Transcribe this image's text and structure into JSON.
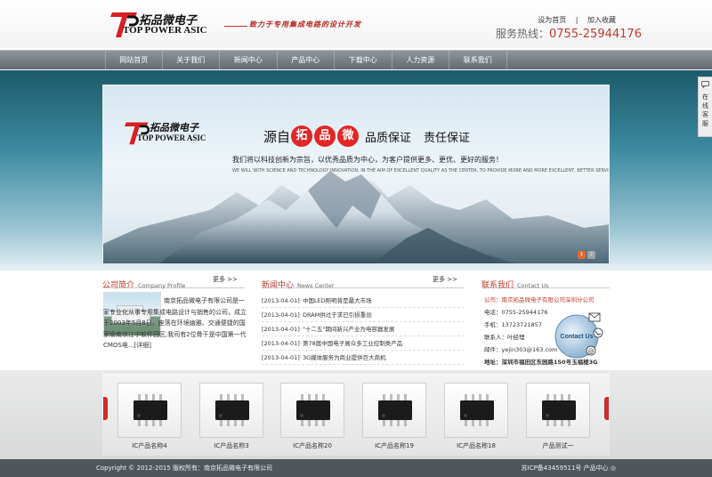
{
  "header": {
    "logo_cn": "拓品微电子",
    "logo_en": "TOP POWER ASIC",
    "slogan": "致力于专用集成电路的设计开发",
    "set_home": "设为首页",
    "separator": "|",
    "add_favorite": "加入收藏",
    "hotline_label": "服务热线：",
    "hotline_number": "0755-25944176"
  },
  "nav": {
    "items": [
      "网站首页",
      "关于我们",
      "新闻中心",
      "产品中心",
      "下载中心",
      "人力资源",
      "联系我们"
    ]
  },
  "banner": {
    "logo_cn": "拓品微电子",
    "logo_en": "TOP POWER ASIC",
    "headline_pre": "源自",
    "headline_chars": [
      "拓",
      "品",
      "微"
    ],
    "headline_mid": "品质保证",
    "headline_post": "责任保证",
    "line_cn": "我们将以科技创新为宗旨，以优秀品质为中心，为客户提供更多、更优、更好的服务！",
    "line_en": "WE WILL WITH SCIENCE AND TECHNOLOGY INNOVATION, IN THE AIM OF EXCELLENT QUALITY AS THE CENTER, TO PROVIDE MORE AND MORE EXCELLENT, BETTER SERVICE!",
    "dots": [
      "1",
      "2"
    ]
  },
  "side_tab": {
    "text": "在线客服"
  },
  "about": {
    "title_cn": "公司简介",
    "title_en": "Company Profile",
    "more": "更多 >>",
    "text": "南京拓品微电子有限公司是一家专业化从事专用集成电路设计与销售的公司，成立于2003年5月8日，座落在环境幽雅、交通便捷的国家级南京江宁软件园区,我司有2位骨干是中国第一代CMOS电...[详细]"
  },
  "news": {
    "title_cn": "新闻中心",
    "title_en": "News Center",
    "more": "更多 >>",
    "items": [
      {
        "date": "[2013-04-01]",
        "title": "中国LED照明将是最大市场"
      },
      {
        "date": "[2013-04-01]",
        "title": "DRAM供过于求已引损重创"
      },
      {
        "date": "[2013-04-01]",
        "title": "\"十二五\"期间新兴产业为电容器发展"
      },
      {
        "date": "[2013-04-01]",
        "title": "第78届中国电子展众多工业控制类产品"
      },
      {
        "date": "[2013-04-01]",
        "title": "3G媒体服务为商业提供巨大商机"
      }
    ]
  },
  "contact": {
    "title_cn": "联系我们",
    "title_en": "Contact Us",
    "company": "公司：南京拓品微电子有限公司深圳分公司",
    "phone": "电话：0755-25944176",
    "mobile": "手机：13723721857",
    "person": "联系人：叶经理",
    "email": "邮件：yejin303@163.com",
    "address": "地址：深圳市福田区东园路150号玉福楼3G",
    "badge": "Contact Us"
  },
  "products": {
    "items": [
      "IC产品名称4",
      "IC产品名称3",
      "IC产品名称20",
      "IC产品名称19",
      "IC产品名称18",
      "产品测试一"
    ]
  },
  "footer": {
    "copyright": "Copyright © 2012-2015 版权所有：南京拓品微电子有限公司",
    "icp": "苏ICP备43459511号 产品中心 ◎"
  },
  "colors": {
    "accent": "#c0392b",
    "nav": "#6b7378",
    "footer": "#4f575d"
  }
}
